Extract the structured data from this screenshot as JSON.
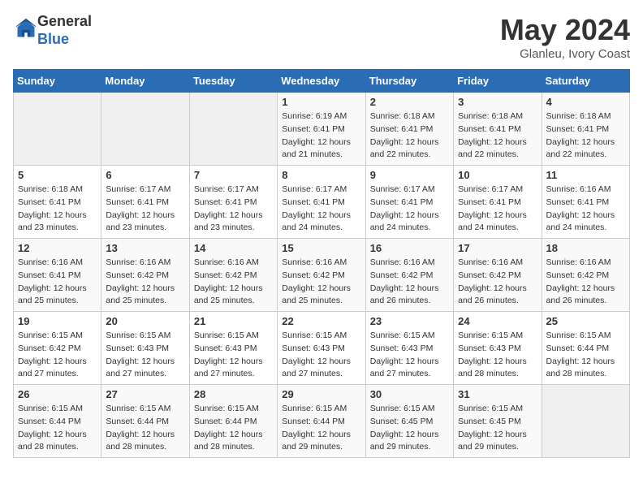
{
  "header": {
    "logo_general": "General",
    "logo_blue": "Blue",
    "month_title": "May 2024",
    "location": "Glanleu, Ivory Coast"
  },
  "weekdays": [
    "Sunday",
    "Monday",
    "Tuesday",
    "Wednesday",
    "Thursday",
    "Friday",
    "Saturday"
  ],
  "weeks": [
    [
      {
        "day": "",
        "info": ""
      },
      {
        "day": "",
        "info": ""
      },
      {
        "day": "",
        "info": ""
      },
      {
        "day": "1",
        "info": "Sunrise: 6:19 AM\nSunset: 6:41 PM\nDaylight: 12 hours\nand 21 minutes."
      },
      {
        "day": "2",
        "info": "Sunrise: 6:18 AM\nSunset: 6:41 PM\nDaylight: 12 hours\nand 22 minutes."
      },
      {
        "day": "3",
        "info": "Sunrise: 6:18 AM\nSunset: 6:41 PM\nDaylight: 12 hours\nand 22 minutes."
      },
      {
        "day": "4",
        "info": "Sunrise: 6:18 AM\nSunset: 6:41 PM\nDaylight: 12 hours\nand 22 minutes."
      }
    ],
    [
      {
        "day": "5",
        "info": "Sunrise: 6:18 AM\nSunset: 6:41 PM\nDaylight: 12 hours\nand 23 minutes."
      },
      {
        "day": "6",
        "info": "Sunrise: 6:17 AM\nSunset: 6:41 PM\nDaylight: 12 hours\nand 23 minutes."
      },
      {
        "day": "7",
        "info": "Sunrise: 6:17 AM\nSunset: 6:41 PM\nDaylight: 12 hours\nand 23 minutes."
      },
      {
        "day": "8",
        "info": "Sunrise: 6:17 AM\nSunset: 6:41 PM\nDaylight: 12 hours\nand 24 minutes."
      },
      {
        "day": "9",
        "info": "Sunrise: 6:17 AM\nSunset: 6:41 PM\nDaylight: 12 hours\nand 24 minutes."
      },
      {
        "day": "10",
        "info": "Sunrise: 6:17 AM\nSunset: 6:41 PM\nDaylight: 12 hours\nand 24 minutes."
      },
      {
        "day": "11",
        "info": "Sunrise: 6:16 AM\nSunset: 6:41 PM\nDaylight: 12 hours\nand 24 minutes."
      }
    ],
    [
      {
        "day": "12",
        "info": "Sunrise: 6:16 AM\nSunset: 6:41 PM\nDaylight: 12 hours\nand 25 minutes."
      },
      {
        "day": "13",
        "info": "Sunrise: 6:16 AM\nSunset: 6:42 PM\nDaylight: 12 hours\nand 25 minutes."
      },
      {
        "day": "14",
        "info": "Sunrise: 6:16 AM\nSunset: 6:42 PM\nDaylight: 12 hours\nand 25 minutes."
      },
      {
        "day": "15",
        "info": "Sunrise: 6:16 AM\nSunset: 6:42 PM\nDaylight: 12 hours\nand 25 minutes."
      },
      {
        "day": "16",
        "info": "Sunrise: 6:16 AM\nSunset: 6:42 PM\nDaylight: 12 hours\nand 26 minutes."
      },
      {
        "day": "17",
        "info": "Sunrise: 6:16 AM\nSunset: 6:42 PM\nDaylight: 12 hours\nand 26 minutes."
      },
      {
        "day": "18",
        "info": "Sunrise: 6:16 AM\nSunset: 6:42 PM\nDaylight: 12 hours\nand 26 minutes."
      }
    ],
    [
      {
        "day": "19",
        "info": "Sunrise: 6:15 AM\nSunset: 6:42 PM\nDaylight: 12 hours\nand 27 minutes."
      },
      {
        "day": "20",
        "info": "Sunrise: 6:15 AM\nSunset: 6:43 PM\nDaylight: 12 hours\nand 27 minutes."
      },
      {
        "day": "21",
        "info": "Sunrise: 6:15 AM\nSunset: 6:43 PM\nDaylight: 12 hours\nand 27 minutes."
      },
      {
        "day": "22",
        "info": "Sunrise: 6:15 AM\nSunset: 6:43 PM\nDaylight: 12 hours\nand 27 minutes."
      },
      {
        "day": "23",
        "info": "Sunrise: 6:15 AM\nSunset: 6:43 PM\nDaylight: 12 hours\nand 27 minutes."
      },
      {
        "day": "24",
        "info": "Sunrise: 6:15 AM\nSunset: 6:43 PM\nDaylight: 12 hours\nand 28 minutes."
      },
      {
        "day": "25",
        "info": "Sunrise: 6:15 AM\nSunset: 6:44 PM\nDaylight: 12 hours\nand 28 minutes."
      }
    ],
    [
      {
        "day": "26",
        "info": "Sunrise: 6:15 AM\nSunset: 6:44 PM\nDaylight: 12 hours\nand 28 minutes."
      },
      {
        "day": "27",
        "info": "Sunrise: 6:15 AM\nSunset: 6:44 PM\nDaylight: 12 hours\nand 28 minutes."
      },
      {
        "day": "28",
        "info": "Sunrise: 6:15 AM\nSunset: 6:44 PM\nDaylight: 12 hours\nand 28 minutes."
      },
      {
        "day": "29",
        "info": "Sunrise: 6:15 AM\nSunset: 6:44 PM\nDaylight: 12 hours\nand 29 minutes."
      },
      {
        "day": "30",
        "info": "Sunrise: 6:15 AM\nSunset: 6:45 PM\nDaylight: 12 hours\nand 29 minutes."
      },
      {
        "day": "31",
        "info": "Sunrise: 6:15 AM\nSunset: 6:45 PM\nDaylight: 12 hours\nand 29 minutes."
      },
      {
        "day": "",
        "info": ""
      }
    ]
  ]
}
